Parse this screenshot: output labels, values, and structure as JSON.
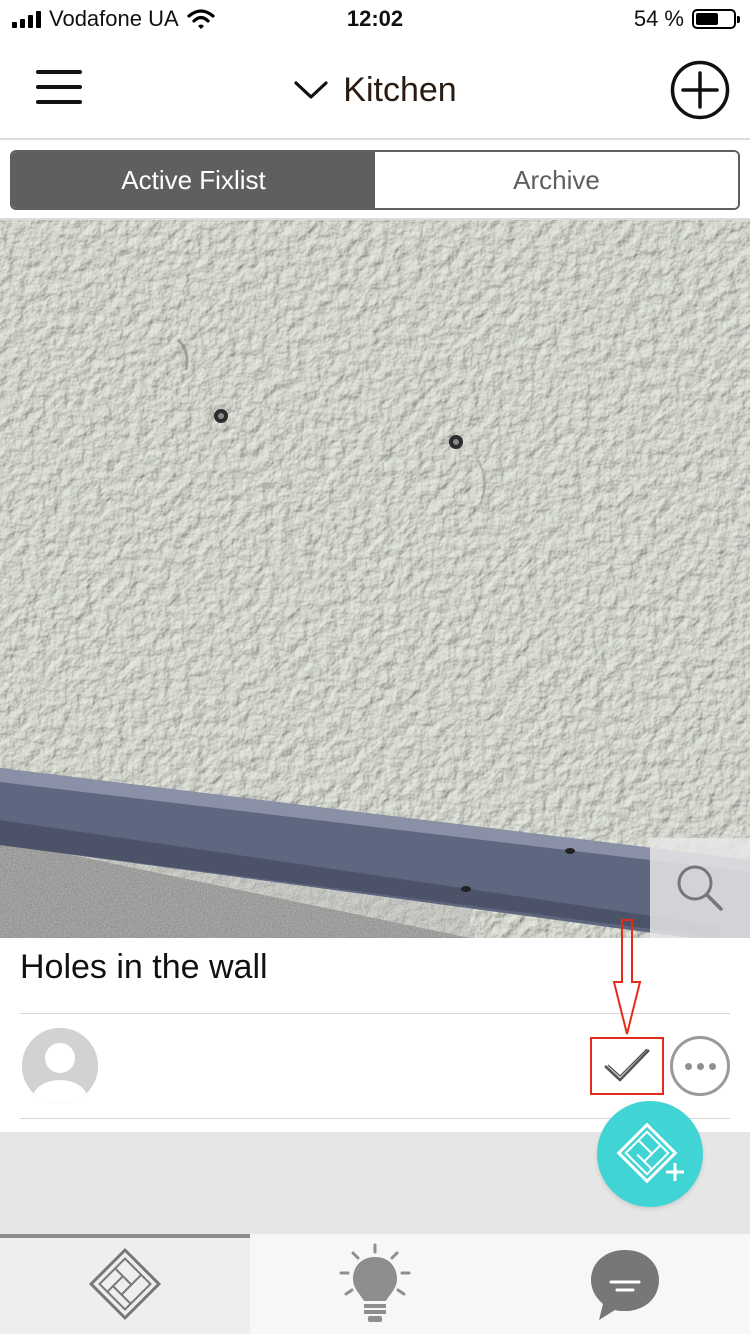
{
  "status_bar": {
    "carrier": "Vodafone UA",
    "time": "12:02",
    "battery_percent": "54 %",
    "battery_level": 0.54
  },
  "header": {
    "title": "Kitchen",
    "menu_icon": "hamburger-menu-icon",
    "dropdown_icon": "chevron-down-icon",
    "add_icon": "plus-circle-icon"
  },
  "tabs": [
    {
      "label": "Active Fixlist",
      "active": true
    },
    {
      "label": "Archive",
      "active": false
    }
  ],
  "card": {
    "title": "Holes in the wall",
    "zoom_icon": "magnifier-icon",
    "resolve_icon": "checkmark-icon",
    "more_icon": "ellipsis-icon",
    "avatar_icon": "user-avatar-icon"
  },
  "fab": {
    "icon": "floorplan-add-icon",
    "color": "#41d4d4"
  },
  "bottom_tabs": [
    {
      "icon": "floorplan-icon",
      "active": true
    },
    {
      "icon": "lightbulb-icon",
      "active": false
    },
    {
      "icon": "chat-bubble-icon",
      "active": false
    }
  ],
  "colors": {
    "accent": "#41d4d4",
    "highlight_red": "#e32b18",
    "segmented_dark": "#5f5f5f"
  }
}
